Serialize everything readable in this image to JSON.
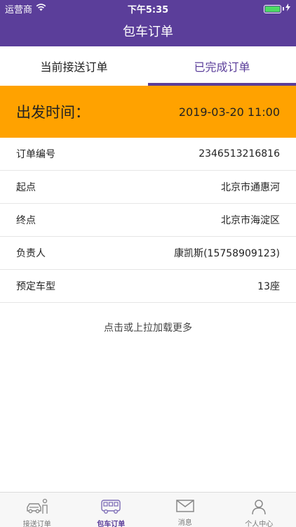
{
  "status_bar": {
    "carrier": "运营商",
    "time": "下午5:35"
  },
  "nav": {
    "title": "包车订单"
  },
  "tabs": [
    {
      "label": "当前接送订单",
      "active": false
    },
    {
      "label": "已完成订单",
      "active": true
    }
  ],
  "banner": {
    "label": "出发时间：",
    "value": "2019-03-20 11:00"
  },
  "order": {
    "rows": [
      {
        "label": "订单编号",
        "value": "2346513216816"
      },
      {
        "label": "起点",
        "value": "北京市通惠河"
      },
      {
        "label": "终点",
        "value": "北京市海淀区"
      },
      {
        "label": "负责人",
        "value": "康凯斯(15758909123)"
      },
      {
        "label": "预定车型",
        "value": "13座"
      }
    ]
  },
  "load_more": "点击或上拉加载更多",
  "bottom_tabs": [
    {
      "label": "接送订单",
      "icon": "car-person-icon",
      "active": false
    },
    {
      "label": "包车订单",
      "icon": "bus-icon",
      "active": true
    },
    {
      "label": "消息",
      "icon": "envelope-icon",
      "active": false
    },
    {
      "label": "个人中心",
      "icon": "person-icon",
      "active": false
    }
  ],
  "colors": {
    "primary": "#5b3e9a",
    "banner": "#ffa200",
    "battery": "#4cd964"
  }
}
